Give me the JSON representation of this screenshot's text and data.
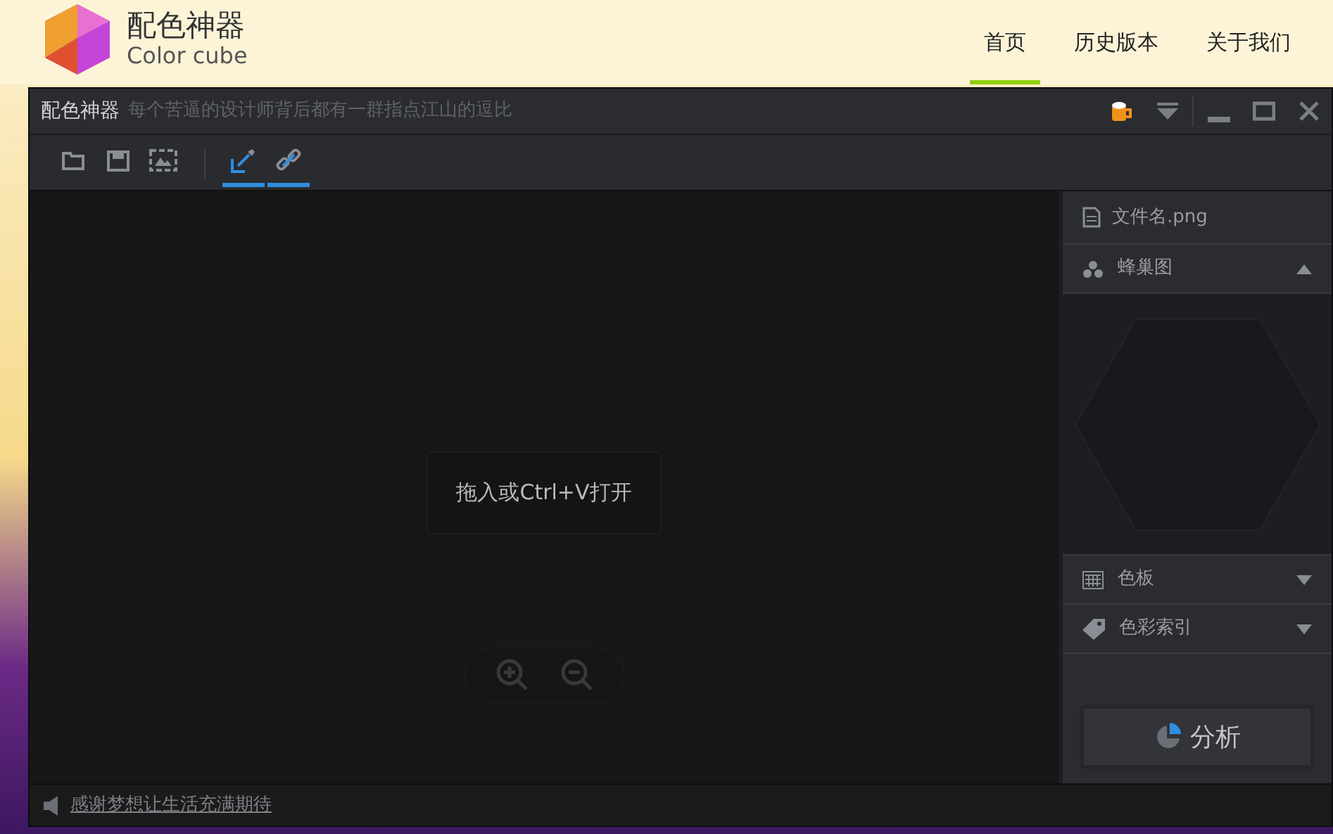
{
  "site": {
    "logo_title": "配色神器",
    "logo_subtitle": "Color cube"
  },
  "nav": [
    {
      "label": "首页",
      "selected": true
    },
    {
      "label": "历史版本",
      "selected": false
    },
    {
      "label": "关于我们",
      "selected": false
    }
  ],
  "window": {
    "title": "配色神器",
    "slogan": "每个苦逼的设计师背后都有一群指点江山的逗比"
  },
  "toolbar": [
    {
      "kind": "open",
      "active": false
    },
    {
      "kind": "save",
      "active": false
    },
    {
      "kind": "image",
      "active": false
    },
    {
      "kind": "eyedropper",
      "active": true
    },
    {
      "kind": "link",
      "active": true
    }
  ],
  "canvas": {
    "hint": "拖入或Ctrl+V打开"
  },
  "panel": {
    "file_name": "文件名.png",
    "sections": [
      {
        "kind": "honeycomb",
        "label": "蜂巢图",
        "expanded": true
      },
      {
        "kind": "palette",
        "label": "色板",
        "expanded": false
      },
      {
        "kind": "index",
        "label": "色彩索引",
        "expanded": false
      }
    ],
    "analyze_button": "分析"
  },
  "status_bar": {
    "message": "感谢梦想让生活充满期待"
  }
}
